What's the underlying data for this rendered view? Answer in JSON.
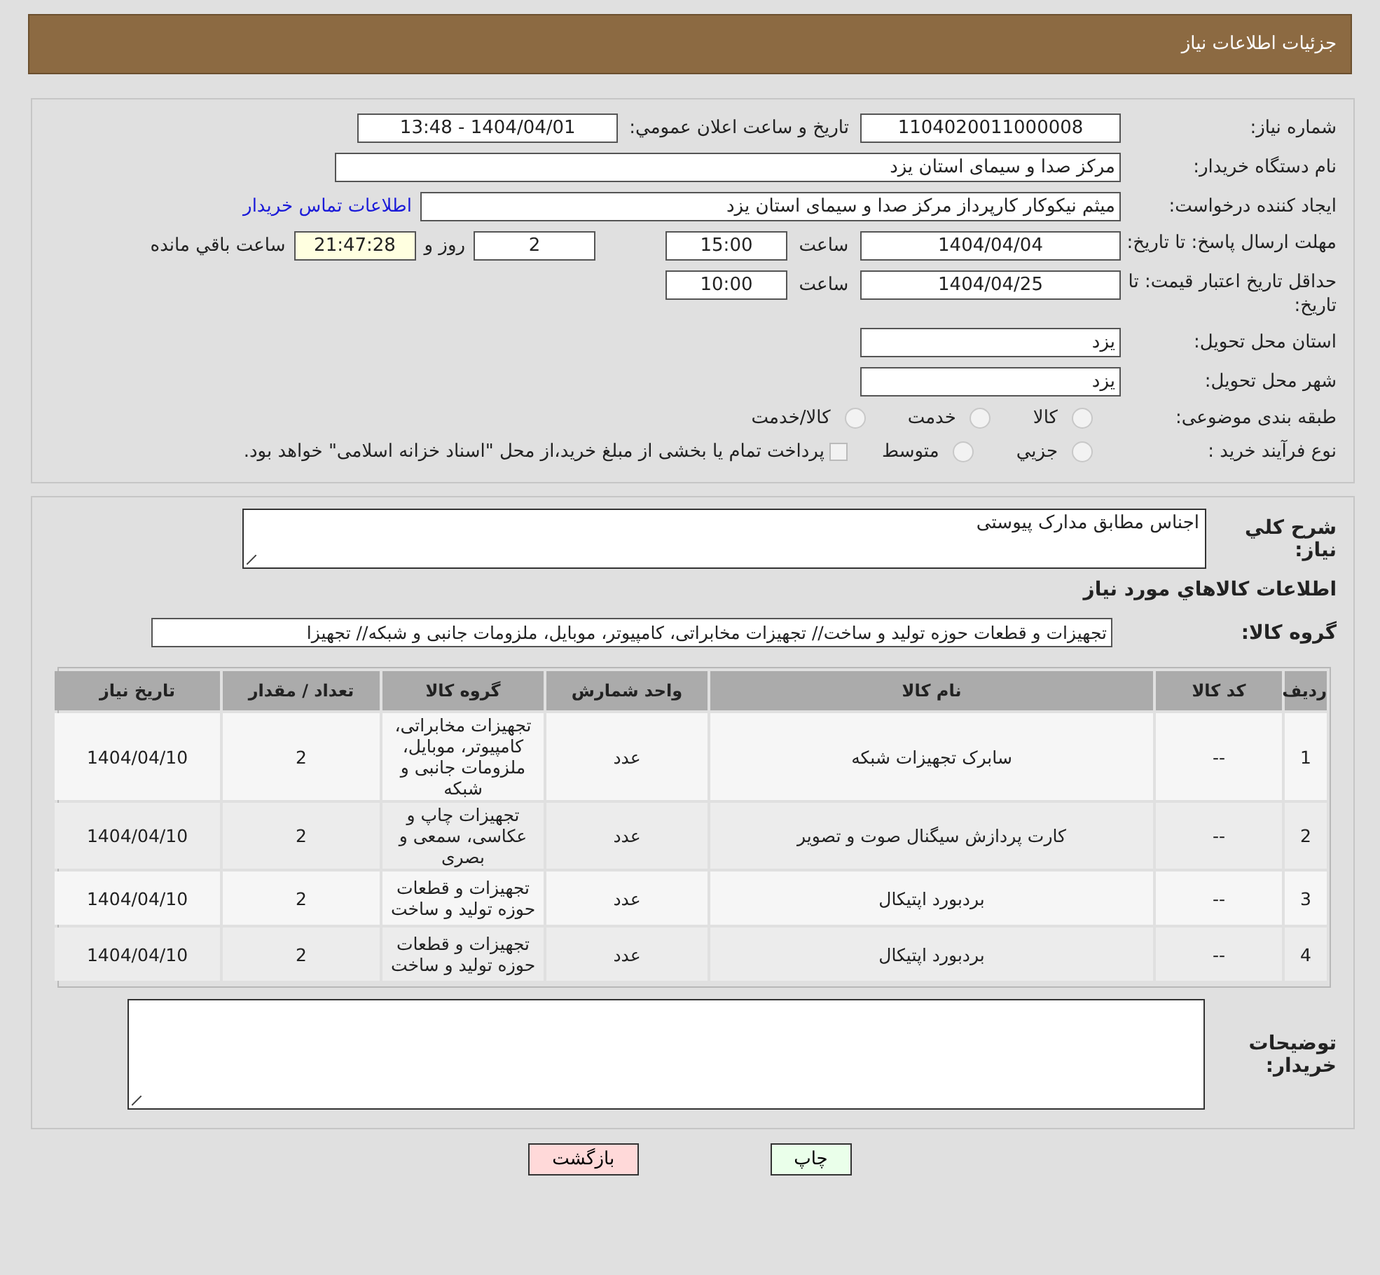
{
  "header": {
    "title": "جزئیات اطلاعات نیاز"
  },
  "details": {
    "need_number": {
      "label": "شماره نیاز:",
      "value": "1104020011000008"
    },
    "announce": {
      "label": "تاریخ و ساعت اعلان عمومي:",
      "value": "1404/04/01 - 13:48"
    },
    "buyer_org": {
      "label": "نام دستگاه خریدار:",
      "value": "مرکز صدا و سیمای استان یزد"
    },
    "creator": {
      "label": "ایجاد کننده درخواست:",
      "value": "میثم  نیکوکار کارپرداز مرکز صدا و سیمای استان یزد",
      "link": "اطلاعات تماس خریدار"
    },
    "deadline": {
      "label": "مهلت ارسال پاسخ: تا تاریخ:",
      "date": "1404/04/04",
      "time_label": "ساعت",
      "time": "15:00",
      "days": "2",
      "days_label": "روز و",
      "remaining": "21:47:28",
      "remaining_label": "ساعت باقي مانده"
    },
    "validity": {
      "label": "حداقل تاریخ اعتبار قیمت: تا تاریخ:",
      "date": "1404/04/25",
      "time_label": "ساعت",
      "time": "10:00"
    },
    "province": {
      "label": "استان محل تحویل:",
      "value": "یزد"
    },
    "city": {
      "label": "شهر محل تحویل:",
      "value": "یزد"
    },
    "category": {
      "label": "طبقه بندی موضوعی:",
      "options": [
        {
          "label": "کالا",
          "selected": false
        },
        {
          "label": "خدمت",
          "selected": false
        },
        {
          "label": "کالا/خدمت",
          "selected": false
        }
      ]
    },
    "process": {
      "label": "نوع فرآیند خرید :",
      "options": [
        {
          "label": "جزيي",
          "selected": false
        },
        {
          "label": "متوسط",
          "selected": false
        }
      ],
      "treasury": {
        "checked": false,
        "text": "پرداخت تمام یا بخشی از مبلغ خرید،از محل \"اسناد خزانه اسلامی\" خواهد بود."
      }
    }
  },
  "summary": {
    "label": "شرح كلي نياز:",
    "value": "اجناس مطابق مدارک پیوستی"
  },
  "goods_title": "اطلاعات كالاهاي مورد نياز",
  "goods_group": {
    "label": "گروه کالا:",
    "value": "تجهیزات و قطعات حوزه تولید و ساخت// تجهیزات مخابراتی، کامپیوتر، موبایل، ملزومات جانبی و شبکه// تجهیزا"
  },
  "table": {
    "columns": [
      "رديف",
      "کد کالا",
      "نام کالا",
      "واحد شمارش",
      "گروه کالا",
      "تعداد / مقدار",
      "تاریخ نیاز"
    ],
    "rows": [
      [
        "1",
        "--",
        "سابرک تجهیزات شبکه",
        "عدد",
        "تجهیزات مخابراتی، کامپیوتر، موبایل، ملزومات جانبی و شبکه",
        "2",
        "1404/04/10"
      ],
      [
        "2",
        "--",
        "کارت پردازش سیگنال صوت و تصویر",
        "عدد",
        "تجهیزات چاپ و عکاسی، سمعی و بصری",
        "2",
        "1404/04/10"
      ],
      [
        "3",
        "--",
        "بردبورد اپتیکال",
        "عدد",
        "تجهیزات و قطعات حوزه تولید و ساخت",
        "2",
        "1404/04/10"
      ],
      [
        "4",
        "--",
        "بردبورد اپتیکال",
        "عدد",
        "تجهیزات و قطعات حوزه تولید و ساخت",
        "2",
        "1404/04/10"
      ]
    ]
  },
  "buyer_notes": {
    "label": "توضیحات خریدار:"
  },
  "buttons": [
    {
      "kind": "print",
      "label": "چاپ"
    },
    {
      "kind": "back",
      "label": "بازگشت"
    }
  ]
}
